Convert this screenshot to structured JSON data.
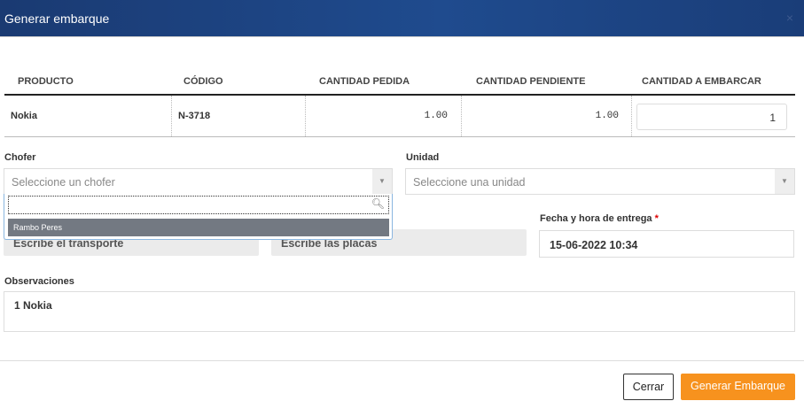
{
  "modal": {
    "title": "Generar embarque",
    "close": "×"
  },
  "table": {
    "headers": [
      "PRODUCTO",
      "CÓDIGO",
      "CANTIDAD PEDIDA",
      "CANTIDAD PENDIENTE",
      "CANTIDAD A EMBARCAR"
    ],
    "rows": [
      {
        "producto": "Nokia",
        "codigo": "N-3718",
        "pedida": "1.00",
        "pendiente": "1.00",
        "embarcar": "1"
      }
    ]
  },
  "form": {
    "chofer_label": "Chofer",
    "chofer_placeholder": "Seleccione un chofer",
    "chofer_options": [
      "Rambo Peres"
    ],
    "unidad_label": "Unidad",
    "unidad_placeholder": "Seleccione una unidad",
    "transporte_placeholder": "Escribe el transporte",
    "placas_placeholder": "Escribe las placas",
    "fecha_label": "Fecha y hora de entrega",
    "required_mark": "*",
    "fecha_value": "15-06-2022 10:34",
    "obs_label": "Observaciones",
    "obs_value": "1 Nokia"
  },
  "footer": {
    "cerrar": "Cerrar",
    "generar": "Generar Embarque"
  }
}
